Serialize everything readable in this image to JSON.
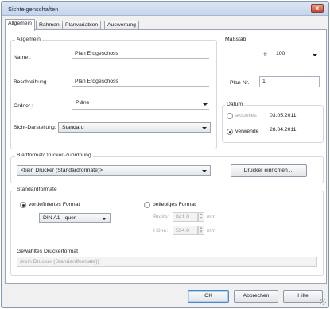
{
  "window": {
    "title": "Sichteigenschaften",
    "close_icon": "close-icon"
  },
  "tabs": [
    {
      "label": "Allgemein"
    },
    {
      "label": "Rahmen"
    },
    {
      "label": "Planvariablen"
    },
    {
      "label": "Auswertung"
    }
  ],
  "allgemein": {
    "group_label": "Allgemein",
    "name_label": "Name :",
    "name_value": "Plan Erdgeschoss",
    "beschreibung_label": "Beschreibung",
    "beschreibung_value": "Plan Erdgeschoss",
    "ordner_label": "Ordner :",
    "ordner_value": "Pläne",
    "sicht_label": "Sicht-Darstellung:",
    "sicht_value": "Standard"
  },
  "massstab": {
    "label": "Maßstab",
    "prefix": "1:",
    "value": "100"
  },
  "plan_nr": {
    "label": "Plan-Nr.:",
    "value": "1"
  },
  "datum": {
    "label": "Datum",
    "aktuelles_label": "aktuelles",
    "aktuelles_value": "03.05.2011",
    "verwende_label": "verwende",
    "verwende_value": "28.04.2011"
  },
  "blattformat": {
    "label": "Blattformat/Drucker-Zuordnung",
    "value": "<kein Drucker (Standardformate)>",
    "button": "Drucker einrichten ..."
  },
  "standardformate": {
    "label": "Standardformate",
    "vordefiniert_label": "vordefiniertes Format",
    "vordefiniert_value": "DIN A1 - quer",
    "beliebig_label": "beliebiges Format",
    "breite_label": "Breite:",
    "breite_value": "841.0",
    "hoehe_label": "Höhe:",
    "hoehe_value": "594.0",
    "unit": "mm"
  },
  "gewaehltes": {
    "label": "Gewähltes Druckerformat",
    "value": "(kein Drucker (Standardformate))"
  },
  "buttons": {
    "ok": "OK",
    "cancel": "Abbrechen",
    "help": "Hilfe"
  }
}
